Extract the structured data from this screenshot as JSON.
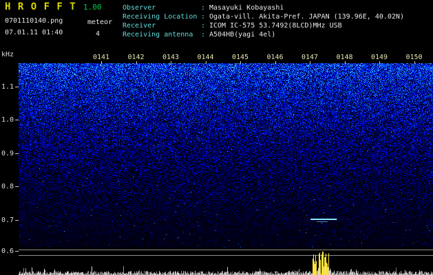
{
  "header": {
    "app_title": "H R O F F T",
    "version": "1.00",
    "filename": "0701110140.png",
    "mode": "meteor",
    "datetime": "07.01.11 01:40",
    "count": "4",
    "separator": ":",
    "info": [
      {
        "label": "Observer",
        "value": "Masayuki Kobayashi"
      },
      {
        "label": "Receiving Location",
        "value": "Ogata-vill. Akita-Pref. JAPAN (139.96E, 40.02N)"
      },
      {
        "label": "Receiver",
        "value": "ICOM IC-575 53.7492(8LCD)MHz USB"
      },
      {
        "label": "Receiving antenna",
        "value": "A504HB(yagi 4el)"
      }
    ]
  },
  "chart_data": {
    "type": "heatmap",
    "title": "HROFFT radio meteor observation spectrogram 0701110140",
    "x_tick_labels": [
      "0141",
      "0142",
      "0143",
      "0144",
      "0145",
      "0146",
      "0147",
      "0148",
      "0149",
      "0150"
    ],
    "x_range_hhmm": [
      "0140",
      "0150"
    ],
    "y_unit_label": "kHz",
    "y_tick_labels": [
      "1.1",
      "1.0",
      "0.9",
      "0.8",
      "0.7",
      "0.6"
    ],
    "y_range_khz": [
      0.58,
      1.17
    ],
    "noise_gradient": "dense bright blue/cyan speckle noise at high frequencies fading to black toward low frequencies",
    "events": [
      {
        "name": "meteor-echo",
        "time_min_after_0140": 7.4,
        "freq_khz": 0.7
      }
    ],
    "power_plot": {
      "description": "received signal strength vs time along bottom strip",
      "baseline": "low gray noise",
      "spikes": [
        {
          "time_min_after_0140": 7.4,
          "color": "#ffe23c",
          "relative_height": "tall"
        }
      ]
    }
  },
  "colors": {
    "background": "#000000",
    "title": "#d9d900",
    "version": "#00cc44",
    "header_text": "#e6e6e6",
    "info_label": "#62dcdc",
    "info_value": "#e8e8e8",
    "time_label": "#e6e6b4",
    "axis_label": "#dddddd",
    "tick": "#cccccc",
    "grid_line": "#8f8f8f",
    "echo": "#86ecff",
    "spike_yellow": "#ffe23c"
  }
}
